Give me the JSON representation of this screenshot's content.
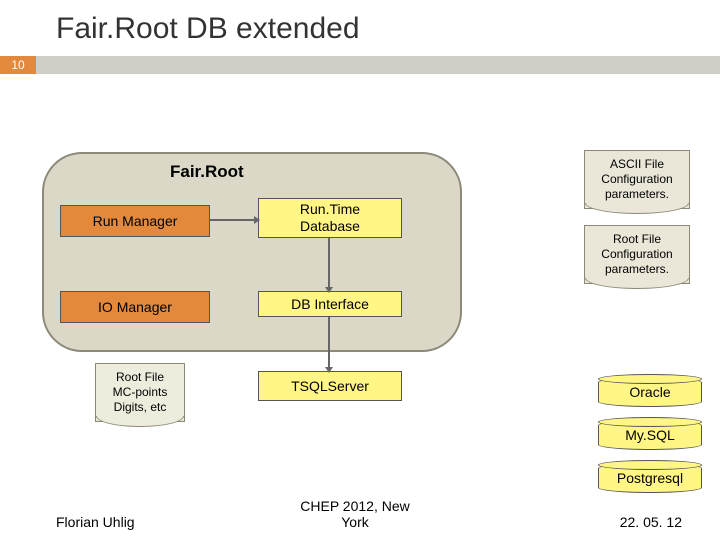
{
  "slide": {
    "title": "Fair.Root DB extended",
    "number": "10"
  },
  "container": {
    "title": "Fair.Root"
  },
  "boxes": {
    "run_manager": "Run Manager",
    "runtime_db": "Run.Time\nDatabase",
    "io_manager": "IO Manager",
    "db_interface": "DB Interface",
    "tsql": "TSQLServer"
  },
  "notes": {
    "ascii": "ASCII File\nConfiguration\nparameters.",
    "rootfile": "Root File\nConfiguration\nparameters.",
    "mcpoints": "Root File\nMC-points\nDigits, etc"
  },
  "databases": {
    "oracle": "Oracle",
    "mysql": "My.SQL",
    "pgsql": "Postgresql"
  },
  "footer": {
    "author": "Florian Uhlig",
    "event": "CHEP 2012, New York",
    "date": "22. 05. 12"
  }
}
